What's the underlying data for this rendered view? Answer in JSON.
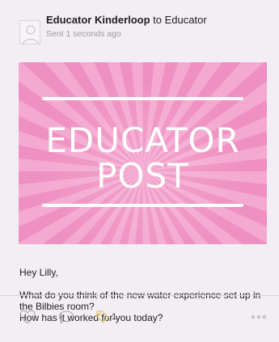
{
  "post": {
    "author": "Educator Kinderloop",
    "recipient_text": " to Educator",
    "sent": "Sent 1 seconds ago",
    "banner": {
      "line1": "EDUCATOR",
      "line2": "POST"
    },
    "greeting": "Hey Lilly,",
    "message": "What do you think of the new water experience set up in the Bilbies room?",
    "question": "How has it worked for you today?"
  },
  "actions": {
    "tag_count": "1"
  },
  "icons": {
    "avatar": "person-icon",
    "like": "heart-icon",
    "comment": "comment-icon",
    "tag": "tag-icon",
    "more": "more-dots-icon"
  },
  "colors": {
    "background": "#f3eef3",
    "banner_pink": "#ef90c2",
    "action_icon": "#a8a8a8",
    "tag_icon": "#e1c36a"
  }
}
